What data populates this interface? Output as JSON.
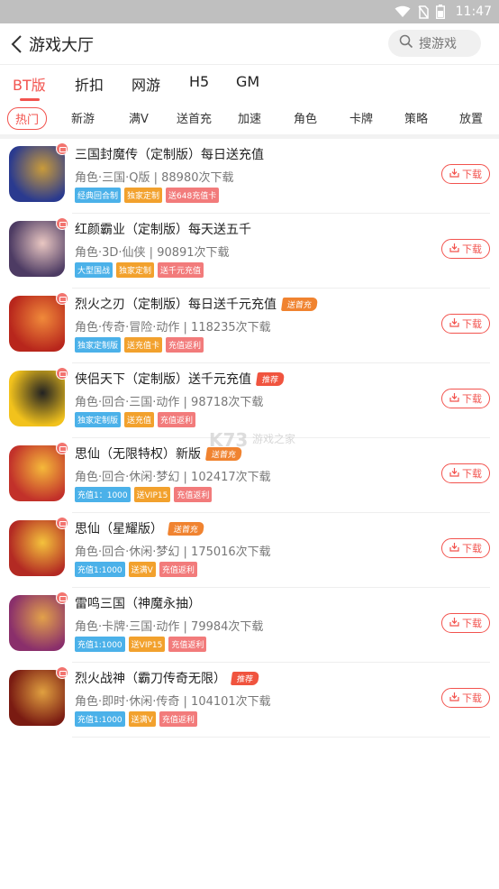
{
  "status_bar": {
    "time": "11:47"
  },
  "header": {
    "title": "游戏大厅",
    "search_placeholder": "搜游戏"
  },
  "main_tabs": [
    {
      "label": "BT版",
      "active": true
    },
    {
      "label": "折扣",
      "active": false
    },
    {
      "label": "网游",
      "active": false
    },
    {
      "label": "H5",
      "active": false
    },
    {
      "label": "GM",
      "active": false
    }
  ],
  "sub_tabs": [
    {
      "label": "热门",
      "active": true
    },
    {
      "label": "新游"
    },
    {
      "label": "满V"
    },
    {
      "label": "送首充"
    },
    {
      "label": "加速"
    },
    {
      "label": "角色"
    },
    {
      "label": "卡牌"
    },
    {
      "label": "策略"
    },
    {
      "label": "放置"
    }
  ],
  "games": [
    {
      "name": "三国封魔传（定制版）每日送充值",
      "flag": "",
      "meta": "角色·三国·Q版 | 88980次下载",
      "tags": [
        {
          "text": "经典回合制",
          "color": "blue"
        },
        {
          "text": "独家定制",
          "color": "orange"
        },
        {
          "text": "送648充值卡",
          "color": "red"
        }
      ],
      "icon_colors": [
        "#2a3a8f",
        "#c99b3a"
      ]
    },
    {
      "name": "红颜霸业（定制版）每天送五千",
      "flag": "",
      "meta": "角色·3D·仙侠 | 90891次下载",
      "tags": [
        {
          "text": "大型国战",
          "color": "blue"
        },
        {
          "text": "独家定制",
          "color": "orange"
        },
        {
          "text": "送千元充值",
          "color": "red"
        }
      ],
      "icon_colors": [
        "#4d3b63",
        "#e9c7c2"
      ]
    },
    {
      "name": "烈火之刃（定制版）每日送千元充值",
      "flag": "送首充",
      "meta": "角色·传奇·冒险·动作 | 118235次下载",
      "tags": [
        {
          "text": "独家定制版",
          "color": "blue"
        },
        {
          "text": "送充值卡",
          "color": "orange"
        },
        {
          "text": "充值返利",
          "color": "red"
        }
      ],
      "icon_colors": [
        "#b8261c",
        "#f08a3a"
      ]
    },
    {
      "name": "侠侣天下（定制版）送千元充值",
      "flag": "推荐",
      "meta": "角色·回合·三国·动作 | 98718次下载",
      "tags": [
        {
          "text": "独家定制版",
          "color": "blue"
        },
        {
          "text": "送充值",
          "color": "orange"
        },
        {
          "text": "充值返利",
          "color": "red"
        }
      ],
      "icon_colors": [
        "#f2c21c",
        "#222222"
      ]
    },
    {
      "name": "思仙（无限特权）新版",
      "flag": "送首充",
      "meta": "角色·回合·休闲·梦幻 | 102417次下载",
      "tags": [
        {
          "text": "充值1：1000",
          "color": "blue"
        },
        {
          "text": "送VIP15",
          "color": "orange"
        },
        {
          "text": "充值返利",
          "color": "red"
        }
      ],
      "icon_colors": [
        "#c2312a",
        "#f5b93a"
      ]
    },
    {
      "name": "思仙（星耀版）",
      "flag": "送首充",
      "meta": "角色·回合·休闲·梦幻 | 175016次下载",
      "tags": [
        {
          "text": "充值1:1000",
          "color": "blue"
        },
        {
          "text": "送满V",
          "color": "orange"
        },
        {
          "text": "充值返利",
          "color": "red"
        }
      ],
      "icon_colors": [
        "#b32a23",
        "#f4c23c"
      ]
    },
    {
      "name": "雷鸣三国（神魔永抽）",
      "flag": "",
      "meta": "角色·卡牌·三国·动作 | 79984次下载",
      "tags": [
        {
          "text": "充值1:1000",
          "color": "blue"
        },
        {
          "text": "送VIP15",
          "color": "orange"
        },
        {
          "text": "充值返利",
          "color": "red"
        }
      ],
      "icon_colors": [
        "#8a2f6b",
        "#e2a14a"
      ]
    },
    {
      "name": "烈火战神（霸刀传奇无限）",
      "flag": "推荐",
      "meta": "角色·即时·休闲·传奇 | 104101次下载",
      "tags": [
        {
          "text": "充值1:1000",
          "color": "blue"
        },
        {
          "text": "送满V",
          "color": "orange"
        },
        {
          "text": "充值返利",
          "color": "red"
        }
      ],
      "icon_colors": [
        "#7a1b12",
        "#e0a040"
      ]
    }
  ],
  "download_label": "下载",
  "watermark": {
    "logo": "K73",
    "sub": "游戏之家"
  }
}
